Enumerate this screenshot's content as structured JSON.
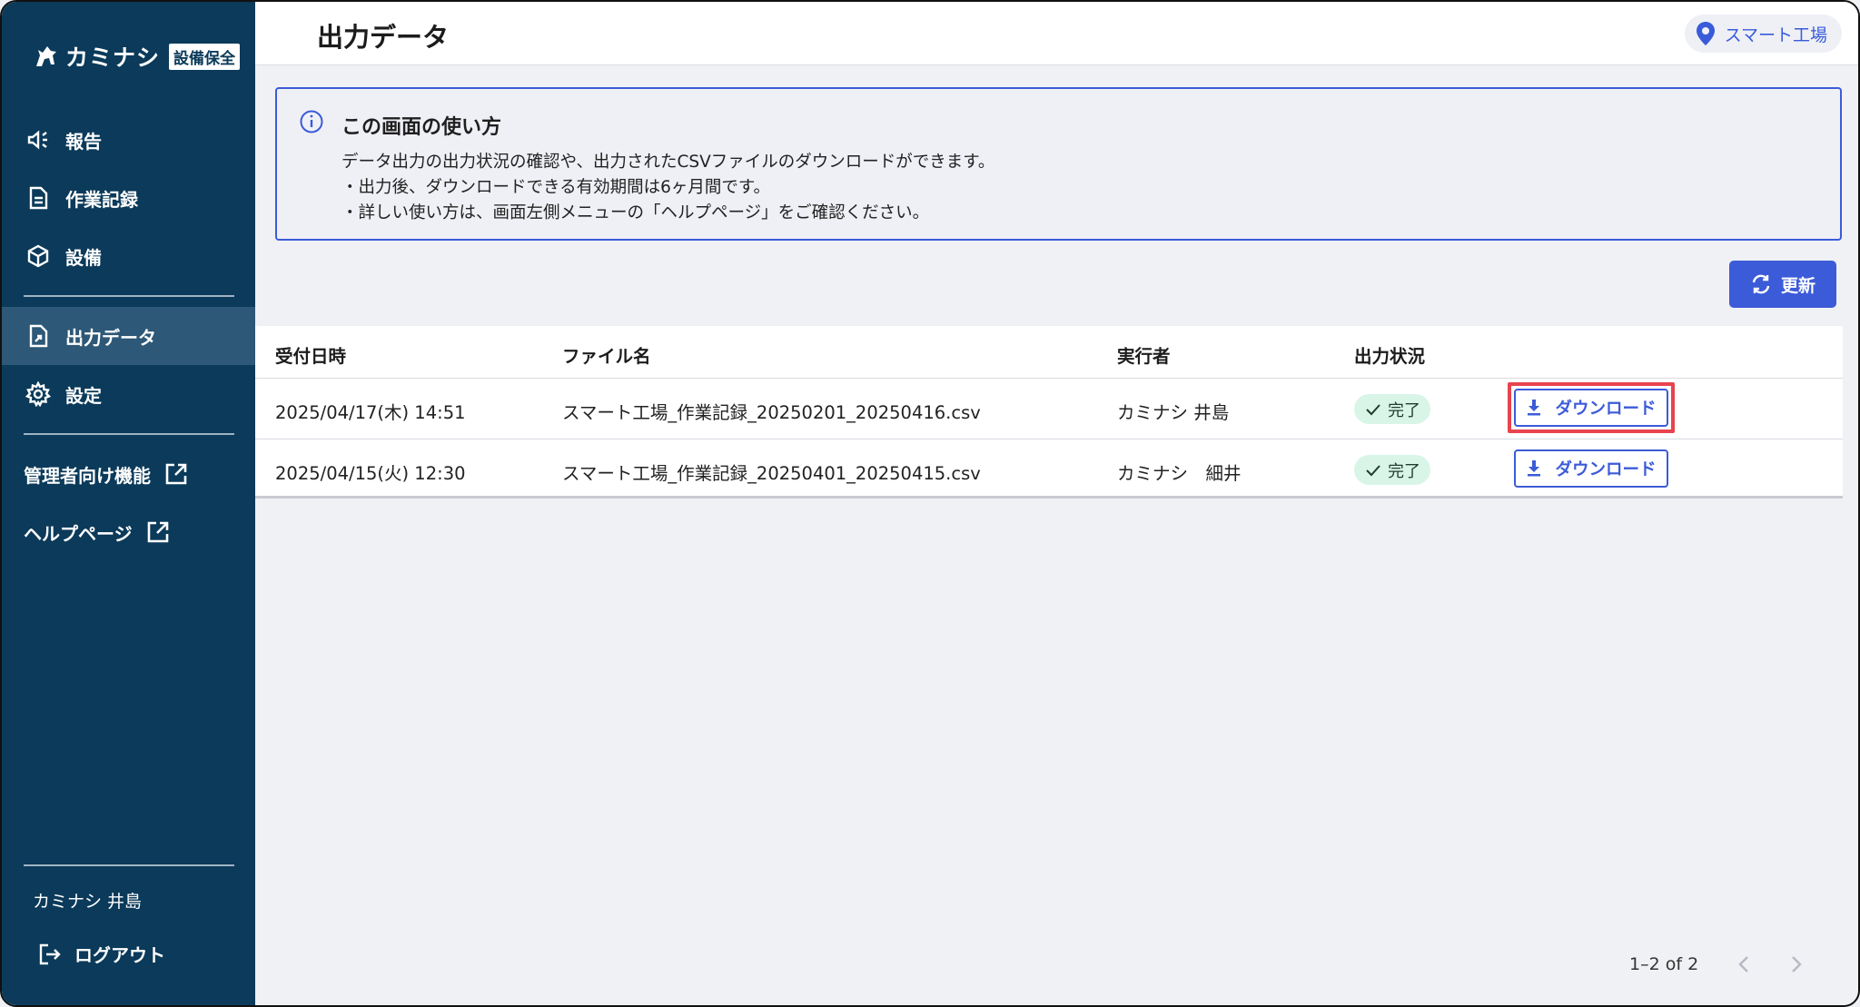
{
  "sidebar": {
    "logo_brand": "カミナシ",
    "logo_sub": "設備保全",
    "items": [
      {
        "label": "報告"
      },
      {
        "label": "作業記録"
      },
      {
        "label": "設備"
      },
      {
        "label": "出力データ"
      },
      {
        "label": "設定"
      }
    ],
    "external": [
      {
        "label": "管理者向け機能"
      },
      {
        "label": "ヘルプページ"
      }
    ],
    "user_name": "カミナシ 井島",
    "logout_label": "ログアウト"
  },
  "header": {
    "title": "出力データ",
    "location": "スマート工場"
  },
  "info": {
    "title": "この画面の使い方",
    "lines": [
      "データ出力の出力状況の確認や、出力されたCSVファイルのダウンロードができます。",
      "・出力後、ダウンロードできる有効期間は6ヶ月間です。",
      "・詳しい使い方は、画面左側メニューの「ヘルプページ」をご確認ください。"
    ]
  },
  "refresh_label": "更新",
  "table": {
    "headers": [
      "受付日時",
      "ファイル名",
      "実行者",
      "出力状況"
    ],
    "rows": [
      {
        "date": "2025/04/17(木) 14:51",
        "file": "スマート工場_作業記録_20250201_20250416.csv",
        "user": "カミナシ 井島",
        "status": "完了",
        "action": "ダウンロード"
      },
      {
        "date": "2025/04/15(火) 12:30",
        "file": "スマート工場_作業記録_20250401_20250415.csv",
        "user": "カミナシ　細井",
        "status": "完了",
        "action": "ダウンロード"
      }
    ]
  },
  "pagination": {
    "range": "1–2 of 2"
  }
}
